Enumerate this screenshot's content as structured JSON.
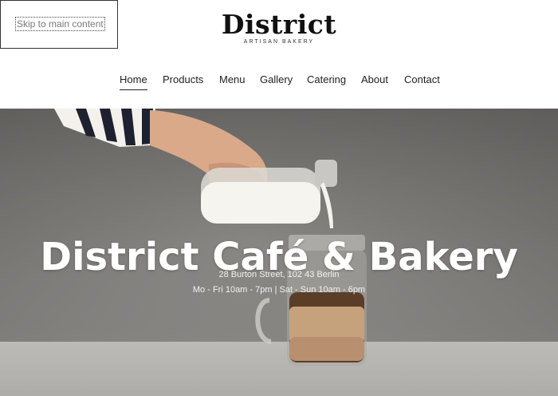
{
  "skip_link": {
    "label": "Skip to main content"
  },
  "logo": {
    "title": "District",
    "subtitle": "ARTISAN BAKERY"
  },
  "nav": {
    "items": [
      {
        "label": "Home",
        "active": true
      },
      {
        "label": "Products"
      },
      {
        "label": "Menu"
      },
      {
        "label": "Gallery"
      },
      {
        "label": "Catering"
      },
      {
        "label": "About"
      },
      {
        "label": "Contact"
      }
    ]
  },
  "hero": {
    "title": "District Café & Bakery",
    "address": "28 Burton Street, 102 43 Berlin",
    "hours": "Mo - Fri 10am - 7pm | Sat - Sun 10am - 6pm"
  }
}
